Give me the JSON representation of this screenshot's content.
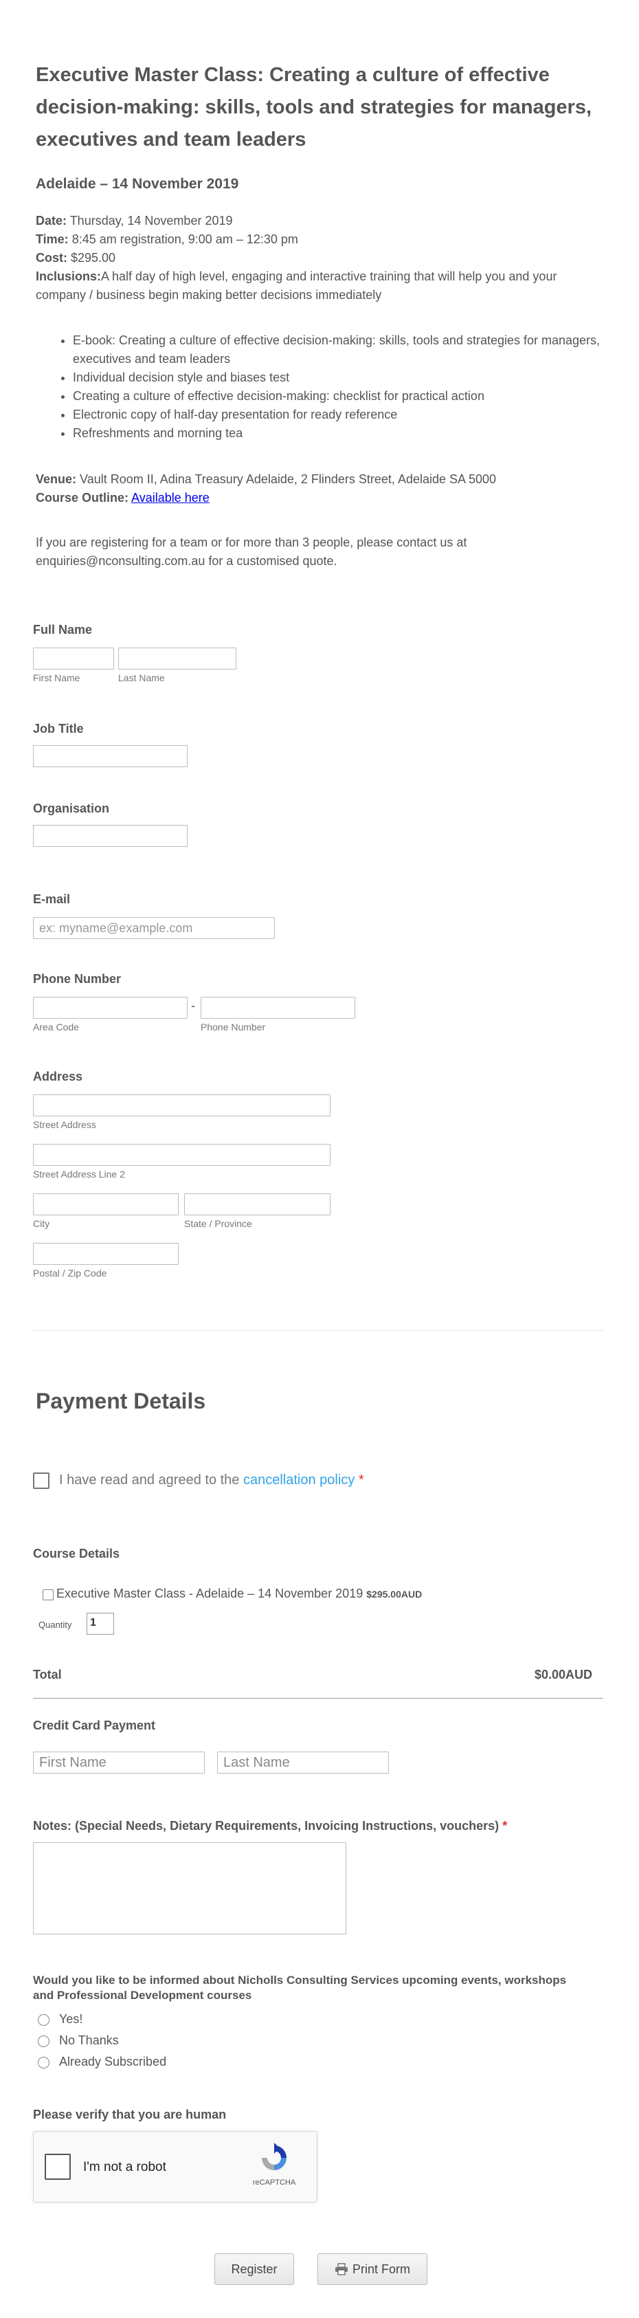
{
  "event": {
    "title": "Executive Master Class: Creating a culture of effective decision-making: skills, tools and strategies for managers, executives and team leaders",
    "location_date": "Adelaide – 14 November 2019",
    "date_label": "Date:",
    "date_value": " Thursday, 14 November 2019",
    "time_label": "Time:",
    "time_value": " 8:45 am registration, 9:00 am – 12:30 pm",
    "cost_label": "Cost:",
    "cost_value": " $295.00",
    "inclusions_label": "Inclusions:",
    "inclusions_value": "A half day of high level, engaging and interactive training that will help you and your company / business begin making better decisions immediately",
    "inclusions_items": [
      "E-book: Creating a culture of effective decision-making: skills, tools and strategies for managers, executives and team leaders",
      "Individual decision style and biases test",
      "Creating a culture of effective decision-making: checklist for practical action",
      "Electronic copy of half-day presentation for ready reference",
      "Refreshments and morning tea"
    ],
    "venue_label": "Venue:",
    "venue_value": " Vault Room II, Adina Treasury Adelaide, 2 Flinders Street, Adelaide SA 5000",
    "outline_label": "Course Outline:",
    "outline_link": "Available here",
    "team_note": "If you are registering for a team or for more than 3 people, please contact us at enquiries@nconsulting.com.au for a customised quote."
  },
  "form": {
    "full_name": {
      "label": "Full Name",
      "first_sub": "First Name",
      "last_sub": "Last Name",
      "first_value": "",
      "last_value": ""
    },
    "job_title": {
      "label": "Job Title",
      "value": ""
    },
    "organisation": {
      "label": "Organisation",
      "value": ""
    },
    "email": {
      "label": "E-mail",
      "placeholder": "ex: myname@example.com"
    },
    "phone": {
      "label": "Phone Number",
      "separator": "-",
      "area_sub": "Area Code",
      "number_sub": "Phone Number"
    },
    "address": {
      "label": "Address",
      "street_sub": "Street Address",
      "street2_sub": "Street Address Line 2",
      "city_sub": "City",
      "state_sub": "State / Province",
      "postal_sub": "Postal / Zip Code"
    },
    "payment_heading": "Payment Details",
    "cancellation": {
      "text": "I have read and agreed to the ",
      "link": "cancellation policy",
      "required": "*"
    },
    "course_details": {
      "label": "Course Details",
      "product_name": "Executive Master Class - Adelaide – 14 November 2019",
      "product_price": "$295.00AUD",
      "quantity_label": "Quantity",
      "quantity_value": "1"
    },
    "total": {
      "label": "Total",
      "value": "$0.00AUD"
    },
    "credit_card": {
      "label": "Credit Card Payment",
      "first_placeholder": "First Name",
      "last_placeholder": "Last Name"
    },
    "notes": {
      "label": "Notes: (Special Needs, Dietary Requirements, Invoicing Instructions, vouchers)",
      "required": "*"
    },
    "updates": {
      "label": "Would you like to be informed about Nicholls Consulting Services  upcoming events, workshops and Professional Development courses",
      "options": [
        "Yes!",
        "No Thanks",
        "Already Subscribed"
      ]
    },
    "captcha": {
      "label": "Please verify that you are human",
      "checkbox_text": "I'm not a robot",
      "brand": "reCAPTCHA"
    },
    "buttons": {
      "register": "Register",
      "print": "Print Form"
    }
  }
}
